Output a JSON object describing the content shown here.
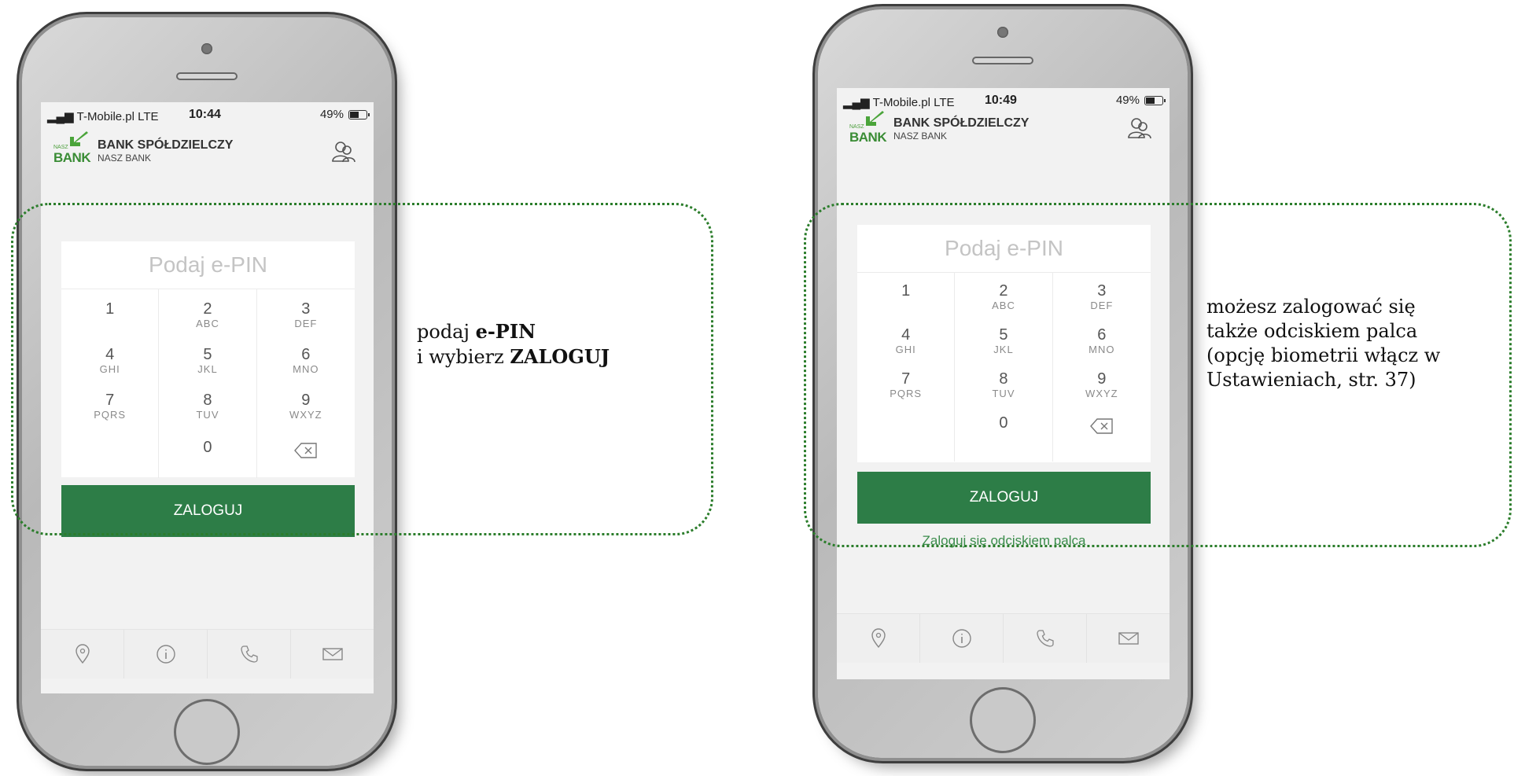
{
  "colors": {
    "accent_green": "#2d7d47",
    "callout_green": "#2b7d2b",
    "logo_green": "#3a8c35"
  },
  "screens": [
    {
      "status": {
        "signal": "T-Mobile.pl  LTE",
        "time": "10:44",
        "battery": "49%"
      },
      "header": {
        "logo_small": "NASZ",
        "logo_big": "BANK",
        "bank_name": "BANK SPÓŁDZIELCZY",
        "bank_sub": "NASZ BANK"
      },
      "pin_prompt": "Podaj e-PIN",
      "keys": [
        {
          "digit": "1",
          "letters": ""
        },
        {
          "digit": "2",
          "letters": "ABC"
        },
        {
          "digit": "3",
          "letters": "DEF"
        },
        {
          "digit": "4",
          "letters": "GHI"
        },
        {
          "digit": "5",
          "letters": "JKL"
        },
        {
          "digit": "6",
          "letters": "MNO"
        },
        {
          "digit": "7",
          "letters": "PQRS"
        },
        {
          "digit": "8",
          "letters": "TUV"
        },
        {
          "digit": "9",
          "letters": "WXYZ"
        },
        {
          "digit": "",
          "letters": ""
        },
        {
          "digit": "0",
          "letters": ""
        },
        {
          "digit": "",
          "letters": ""
        }
      ],
      "login_label": "ZALOGUJ",
      "bottom_icons": [
        "location-pin-icon",
        "info-icon",
        "phone-icon",
        "mail-icon"
      ]
    },
    {
      "status": {
        "signal": "T-Mobile.pl  LTE",
        "time": "10:49",
        "battery": "49%"
      },
      "header": {
        "logo_small": "NASZ",
        "logo_big": "BANK",
        "bank_name": "BANK SPÓŁDZIELCZY",
        "bank_sub": "NASZ BANK"
      },
      "pin_prompt": "Podaj e-PIN",
      "keys": [
        {
          "digit": "1",
          "letters": ""
        },
        {
          "digit": "2",
          "letters": "ABC"
        },
        {
          "digit": "3",
          "letters": "DEF"
        },
        {
          "digit": "4",
          "letters": "GHI"
        },
        {
          "digit": "5",
          "letters": "JKL"
        },
        {
          "digit": "6",
          "letters": "MNO"
        },
        {
          "digit": "7",
          "letters": "PQRS"
        },
        {
          "digit": "8",
          "letters": "TUV"
        },
        {
          "digit": "9",
          "letters": "WXYZ"
        },
        {
          "digit": "",
          "letters": ""
        },
        {
          "digit": "0",
          "letters": ""
        },
        {
          "digit": "",
          "letters": ""
        }
      ],
      "login_label": "ZALOGUJ",
      "biometric_link": "Zaloguj się odciskiem palca",
      "bottom_icons": [
        "location-pin-icon",
        "info-icon",
        "phone-icon",
        "mail-icon"
      ]
    }
  ],
  "captions": {
    "left": {
      "pre1": "podaj ",
      "bold1": "e-PIN",
      "pre2": "i wybierz ",
      "bold2": "ZALOGUJ"
    },
    "right": {
      "line1": "możesz zalogować się",
      "line2": "także odciskiem palca",
      "line3": "(opcję biometrii włącz w",
      "line4": "Ustawieniach, str. 37)"
    }
  }
}
